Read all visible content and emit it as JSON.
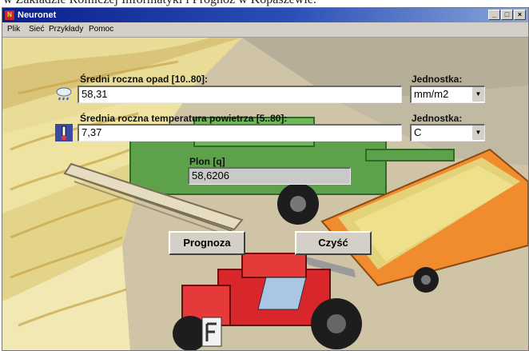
{
  "caption_above": "w Zakładzie Rolniczej Informatyki i Prognoz w Kopaszewie.",
  "window": {
    "title": "Neuronet",
    "app_icon": "neural-net-icon"
  },
  "menu": {
    "items": [
      "Plik",
      "Sieć",
      "Przykłady",
      "Pomoc"
    ]
  },
  "form": {
    "rain": {
      "label": "Średni roczna opad [10..80]:",
      "value": "58,31",
      "icon": "cloud-rain-icon"
    },
    "rain_unit": {
      "label": "Jednostka:",
      "value": "mm/m2"
    },
    "temperature": {
      "label": "Średnia roczna temperatura powietrza [5..80]:",
      "value": "7,37",
      "icon": "thermometer-icon"
    },
    "temp_unit": {
      "label": "Jednostka:",
      "value": "C"
    },
    "yield": {
      "label": "Plon [q]",
      "value": "58,6206"
    }
  },
  "buttons": {
    "predict": "Prognoza",
    "clear": "Czyść"
  },
  "colors": {
    "titlebar": "#0a1e8c",
    "field_bg": "#f2e8a8",
    "tractor": "#d8262a",
    "combine": "#6ab04c",
    "trailer": "#e89a3c"
  }
}
